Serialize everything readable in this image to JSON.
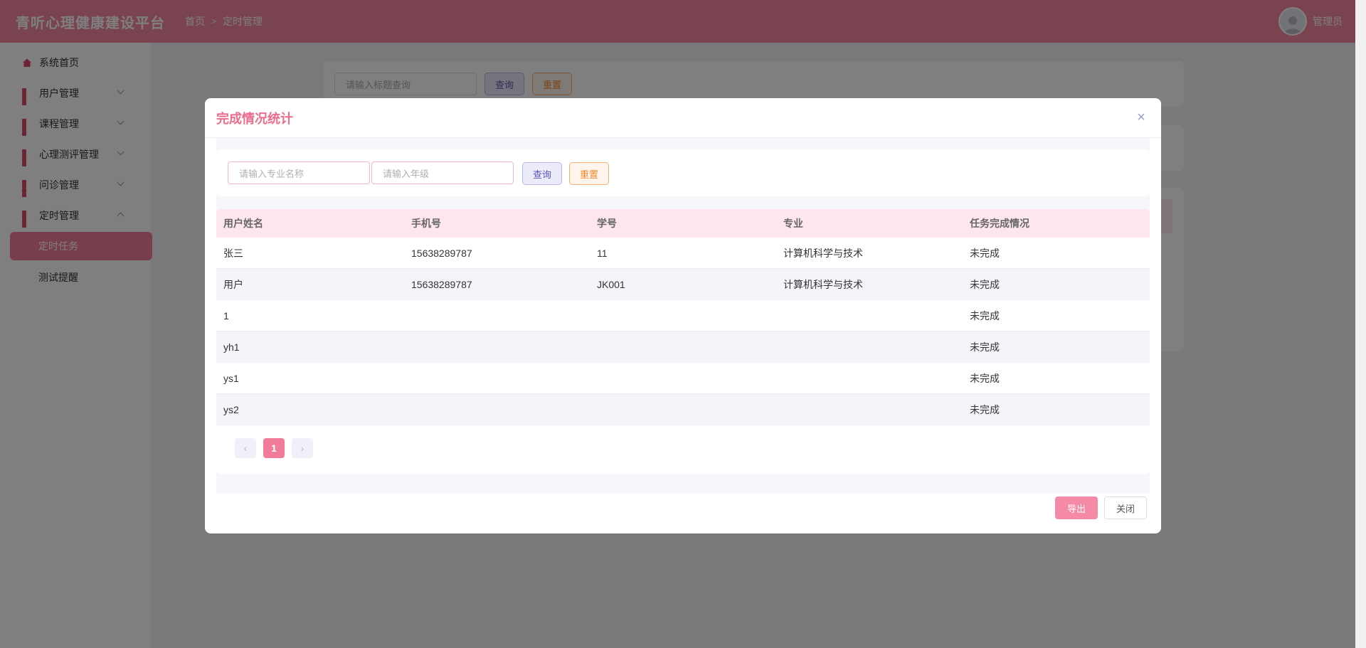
{
  "header": {
    "app_title": "青听心理健康建设平台",
    "breadcrumb": [
      "首页",
      "定时管理"
    ],
    "breadcrumb_sep": ">",
    "user_name": "管理员"
  },
  "sidebar": {
    "items": [
      {
        "label": "系统首页",
        "icon": "home-icon"
      },
      {
        "label": "用户管理",
        "icon": "grid-icon"
      },
      {
        "label": "课程管理",
        "icon": "grid-icon"
      },
      {
        "label": "心理测评管理",
        "icon": "grid-icon"
      },
      {
        "label": "问诊管理",
        "icon": "grid-icon"
      },
      {
        "label": "定时管理",
        "icon": "grid-icon"
      }
    ],
    "sub_items": [
      {
        "label": "定时任务",
        "active": true
      },
      {
        "label": "测试提醒",
        "active": false
      }
    ]
  },
  "background": {
    "search_placeholder": "请输入标题查询",
    "query_label": "查询",
    "reset_label": "重置"
  },
  "modal": {
    "title": "完成情况统计",
    "major_placeholder": "请输入专业名称",
    "grade_placeholder": "请输入年级",
    "query_label": "查询",
    "reset_label": "重置",
    "columns": [
      "用户姓名",
      "手机号",
      "学号",
      "专业",
      "任务完成情况"
    ],
    "rows": [
      [
        "张三",
        "15638289787",
        "11",
        "计算机科学与技术",
        "未完成"
      ],
      [
        "用户",
        "15638289787",
        "JK001",
        "计算机科学与技术",
        "未完成"
      ],
      [
        "1",
        "",
        "",
        "",
        "未完成"
      ],
      [
        "yh1",
        "",
        "",
        "",
        "未完成"
      ],
      [
        "ys1",
        "",
        "",
        "",
        "未完成"
      ],
      [
        "ys2",
        "",
        "",
        "",
        "未完成"
      ]
    ],
    "pagination": {
      "current_page": "1",
      "prev": "‹",
      "next": "›"
    },
    "export_label": "导出",
    "close_label": "关闭"
  },
  "colors": {
    "primary": "#f2869f",
    "title_pink": "#ec6d8c",
    "table_header_bg": "#fde6ec"
  }
}
